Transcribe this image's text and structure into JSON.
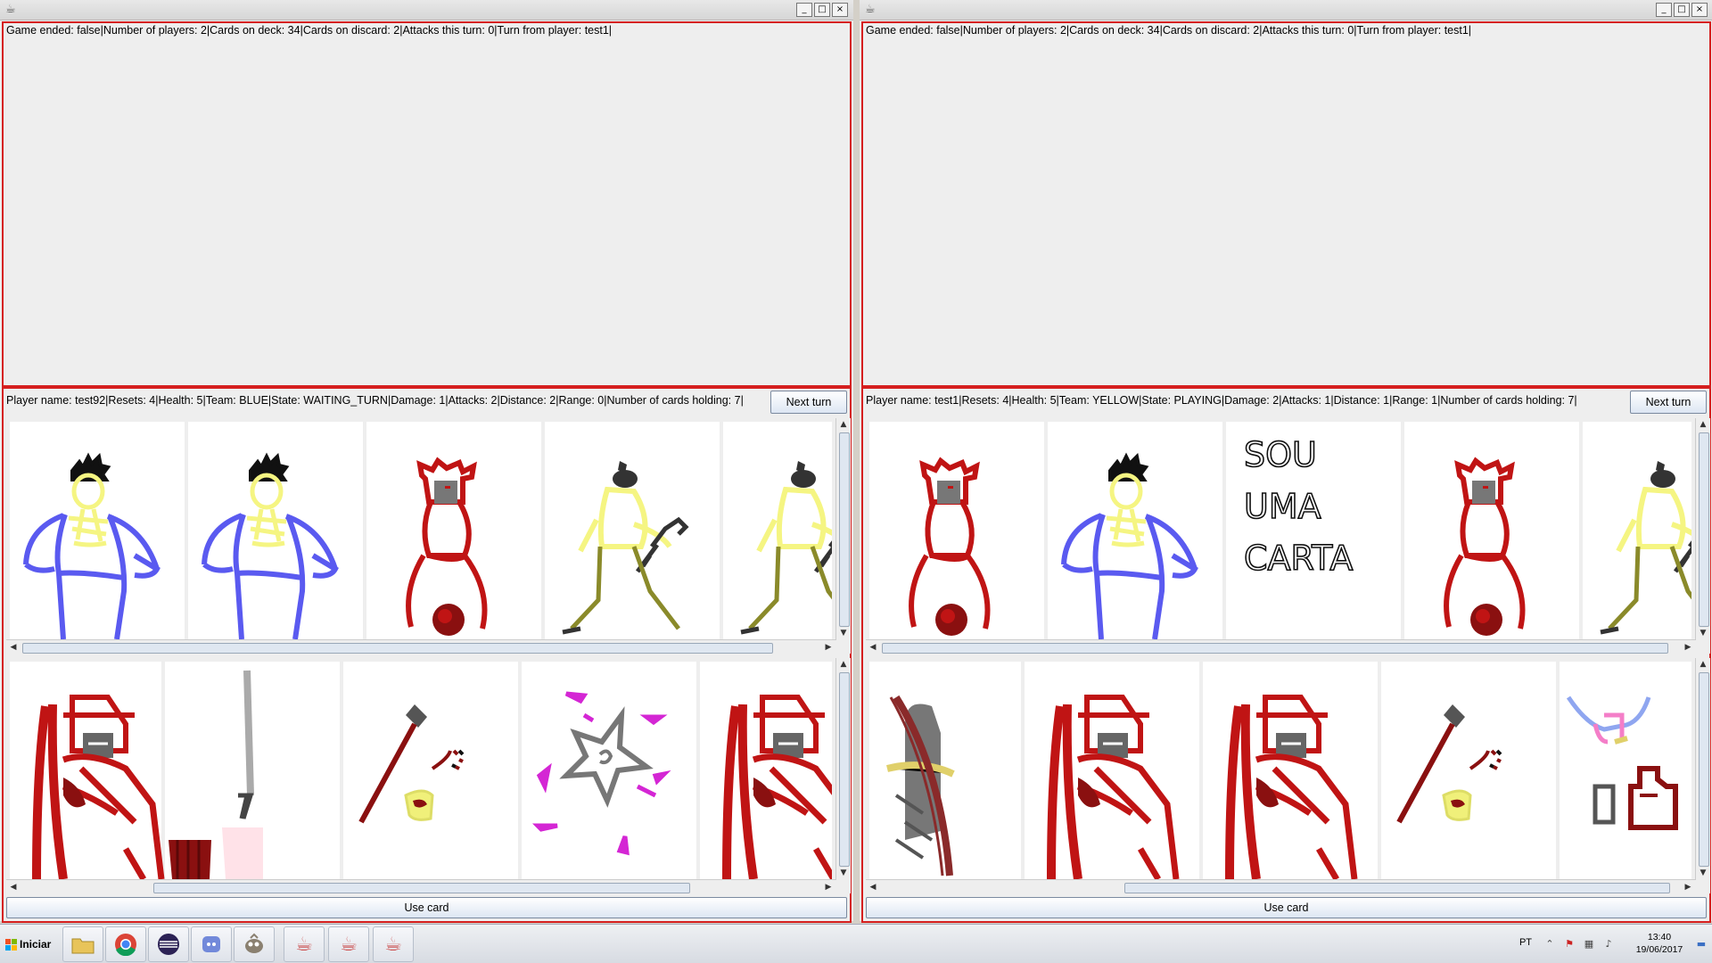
{
  "windows": [
    {
      "status": "Game ended: false|Number of players: 2|Cards on deck: 34|Cards on discard: 2|Attacks this turn: 0|Turn from player: test1|",
      "player_info": "Player name: test92|Resets: 4|Health: 5|Team: BLUE|State: WAITING_TURN|Damage: 1|Attacks: 2|Distance: 2|Range: 0|Number of cards holding: 7|",
      "next_turn_label": "Next turn",
      "use_card_label": "Use card",
      "row1": [
        "blue-ninja",
        "blue-ninja",
        "red-warrior",
        "yellow-samurai",
        "yellow-samurai"
      ],
      "row2": [
        "red-armored",
        "katana",
        "axe",
        "shuriken",
        "red-armored"
      ]
    },
    {
      "status": "Game ended: false|Number of players: 2|Cards on deck: 34|Cards on discard: 2|Attacks this turn: 0|Turn from player: test1|",
      "player_info": "Player name: test1|Resets: 4|Health: 5|Team: YELLOW|State: PLAYING|Damage: 2|Attacks: 1|Distance: 1|Range: 1|Number of cards holding: 7|",
      "next_turn_label": "Next turn",
      "use_card_label": "Use card",
      "row1": [
        "red-warrior",
        "blue-ninja",
        "text-card",
        "red-warrior",
        "yellow-samurai"
      ],
      "row2": [
        "gray-bow",
        "red-armored",
        "red-armored",
        "axe",
        "pots"
      ]
    }
  ],
  "text_card": {
    "line1": "SOU",
    "line2": "UMA",
    "line3": "CARTA"
  },
  "window_buttons": {
    "minimize": "_",
    "maximize": "□",
    "close": "×"
  },
  "taskbar": {
    "start_label": "Iniciar",
    "language": "PT",
    "time": "13:40",
    "date": "19/06/2017"
  },
  "colors": {
    "panel_border": "#d51f1f",
    "blue_team": "#5a5af0",
    "yellow_team": "#f5f582",
    "red": "#c01414"
  }
}
